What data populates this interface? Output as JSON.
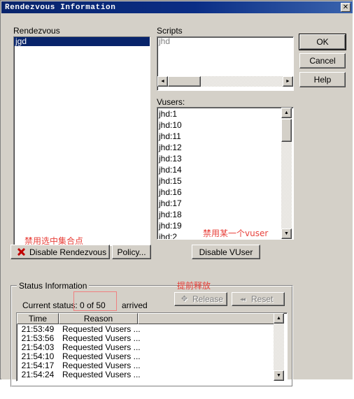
{
  "window": {
    "title": "Rendezvous Information",
    "close_label": "✕"
  },
  "rendezvous": {
    "label": "Rendezvous",
    "items": [
      "jgd"
    ],
    "selected_index": 0,
    "annotation": "禁用选中集合点"
  },
  "scripts": {
    "label": "Scripts",
    "items": [
      "jhd"
    ],
    "scroll_left_arrow": "◄",
    "scroll_right_arrow": "►"
  },
  "vusers": {
    "label": "Vusers:",
    "items": [
      "jhd:1",
      "jhd:10",
      "jhd:11",
      "jhd:12",
      "jhd:13",
      "jhd:14",
      "jhd:15",
      "jhd:16",
      "jhd:17",
      "jhd:18",
      "jhd:19",
      "jhd:2"
    ],
    "annotation": "禁用某一个vuser",
    "scroll_up_arrow": "▲",
    "scroll_down_arrow": "▼"
  },
  "dialog_buttons": {
    "ok": "OK",
    "cancel": "Cancel",
    "help": "Help"
  },
  "actions": {
    "disable_rendezvous": "Disable Rendezvous",
    "policy": "Policy...",
    "disable_vuser": "Disable VUser"
  },
  "status": {
    "group_label": "Status Information",
    "current_status_label": "Current status:",
    "current_status_value": "0 of 50",
    "arrived_label": "arrived",
    "release_label": "Release",
    "reset_label": "Reset",
    "release_annotation": "提前释放",
    "table": {
      "columns": [
        "Time",
        "Reason",
        ""
      ],
      "rows": [
        {
          "time": "21:53:49",
          "reason": "Requested Vusers ..."
        },
        {
          "time": "21:53:56",
          "reason": "Requested Vusers ..."
        },
        {
          "time": "21:54:03",
          "reason": "Requested Vusers ..."
        },
        {
          "time": "21:54:10",
          "reason": "Requested Vusers ..."
        },
        {
          "time": "21:54:17",
          "reason": "Requested Vusers ..."
        },
        {
          "time": "21:54:24",
          "reason": "Requested Vusers ..."
        }
      ],
      "scroll_up_arrow": "▲",
      "scroll_down_arrow": "▼"
    }
  },
  "colors": {
    "titlebar": "#08246b",
    "face": "#d4d0c8",
    "selection": "#08246b",
    "annotation": "#e8403a"
  }
}
